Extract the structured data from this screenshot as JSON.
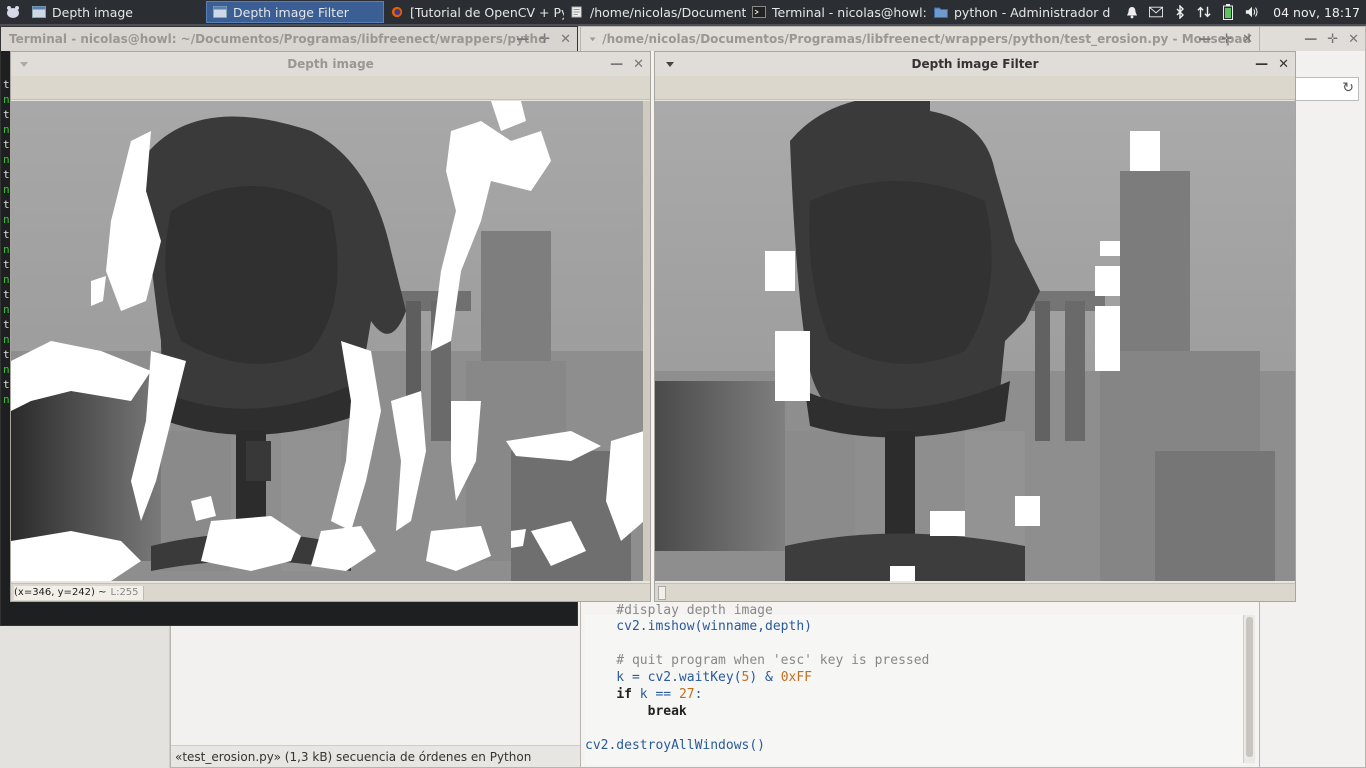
{
  "panel": {
    "tasks": [
      {
        "label": "Depth image",
        "active": false
      },
      {
        "label": "Depth image Filter",
        "active": true
      },
      {
        "label": "[Tutorial de OpenCV + Pyt...",
        "active": false
      },
      {
        "label": "/home/nicolas/Document...",
        "active": false
      },
      {
        "label": "Terminal - nicolas@howl: ...",
        "active": false
      },
      {
        "label": "python - Administrador d...",
        "active": false
      }
    ],
    "tray_icons": [
      "bell-icon",
      "mail-icon",
      "bluetooth-icon",
      "network-icon",
      "battery-icon",
      "volume-icon"
    ],
    "clock": "04 nov, 18:17"
  },
  "terminal": {
    "title": "Terminal - nicolas@howl: ~/Documentos/Programas/libfreenect/wrappers/pytho",
    "glyphs": [
      "t",
      "n",
      "t",
      "n",
      "t",
      "n",
      "t",
      "n",
      "t",
      "n",
      "t",
      "n",
      "t",
      "n",
      "t",
      "n",
      "t",
      "n",
      "t",
      "n",
      "t",
      "n"
    ]
  },
  "mousepad": {
    "title": "/home/nicolas/Documentos/Programas/libfreenect/wrappers/python/test_erosion.py - Mousepad",
    "code": {
      "l0": "    #display depth image",
      "l1a": "    cv2.imshow(winname,depth)",
      "l2": "    # quit program when 'esc' key is pressed",
      "l3a": "    k = cv2.waitKey(",
      "l3b": "5",
      "l3c": ") & ",
      "l3d": "0xFF",
      "l4a": "    ",
      "l4b": "if",
      "l4c": " k == ",
      "l4d": "27",
      "l4e": ":",
      "l5a": "        ",
      "l5b": "break",
      "l6": "cv2.destroyAllWindows()"
    }
  },
  "filemanager": {
    "status": "«test_erosion.py» (1,3 kB) secuencia de órdenes en Python"
  },
  "depth_window": {
    "title": "Depth image",
    "coords": "(x=346, y=242) ~",
    "lvalue": "L:255"
  },
  "filter_window": {
    "title": "Depth image Filter"
  },
  "colors": {
    "panel_bg": "#2b2f33",
    "active_task": "#3b5f95",
    "terminal_green": "#39c139"
  }
}
